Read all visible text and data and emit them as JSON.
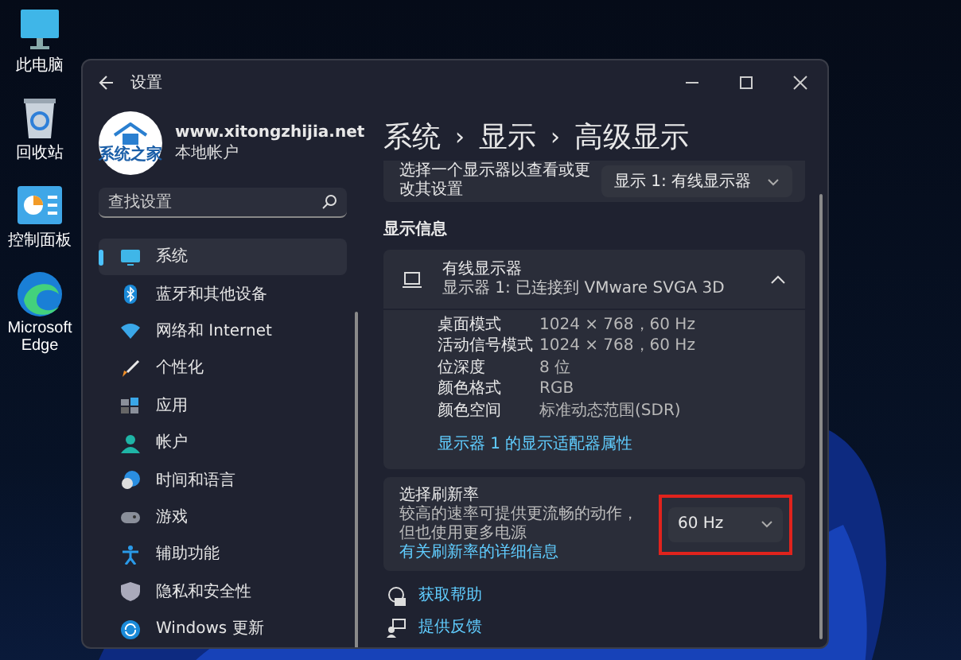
{
  "desktop_icons": [
    {
      "kind": "pc",
      "label": "此电脑"
    },
    {
      "kind": "bin",
      "label": "回收站"
    },
    {
      "kind": "panel",
      "label": "控制面板"
    },
    {
      "kind": "edge",
      "label": "Microsoft Edge"
    }
  ],
  "window": {
    "title": "设置"
  },
  "profile": {
    "logo_text": "系统之家",
    "name": "www.xitongzhijia.net",
    "account_type": "本地帐户"
  },
  "search": {
    "placeholder": "查找设置"
  },
  "sidebar": {
    "items": [
      {
        "label": "系统",
        "selected": true
      },
      {
        "label": "蓝牙和其他设备",
        "selected": false
      },
      {
        "label": "网络和 Internet",
        "selected": false
      },
      {
        "label": "个性化",
        "selected": false
      },
      {
        "label": "应用",
        "selected": false
      },
      {
        "label": "帐户",
        "selected": false
      },
      {
        "label": "时间和语言",
        "selected": false
      },
      {
        "label": "游戏",
        "selected": false
      },
      {
        "label": "辅助功能",
        "selected": false
      },
      {
        "label": "隐私和安全性",
        "selected": false
      },
      {
        "label": "Windows 更新",
        "selected": false
      }
    ]
  },
  "breadcrumb": [
    "系统",
    "显示",
    "高级显示"
  ],
  "breadcrumb_separator": "›",
  "display_select": {
    "label": "选择一个显示器以查看或更改其设置",
    "value": "显示 1: 有线显示器"
  },
  "section_heading": "显示信息",
  "display_info": {
    "title": "有线显示器",
    "subtitle": "显示器 1: 已连接到 VMware SVGA 3D",
    "expanded": true,
    "rows": [
      {
        "label": "桌面模式",
        "value": "1024 × 768，60 Hz"
      },
      {
        "label": "活动信号模式",
        "value": "1024 × 768，60 Hz"
      },
      {
        "label": "位深度",
        "value": "8 位"
      },
      {
        "label": "颜色格式",
        "value": "RGB"
      },
      {
        "label": "颜色空间",
        "value": "标准动态范围(SDR)"
      }
    ],
    "link": "显示器 1 的显示适配器属性"
  },
  "refresh_rate": {
    "title": "选择刷新率",
    "description": "较高的速率可提供更流畅的动作，但也使用更多电源",
    "link": "有关刷新率的详细信息",
    "value": "60 Hz",
    "highlighted": true
  },
  "help_links": [
    {
      "label": "获取帮助"
    },
    {
      "label": "提供反馈"
    }
  ]
}
